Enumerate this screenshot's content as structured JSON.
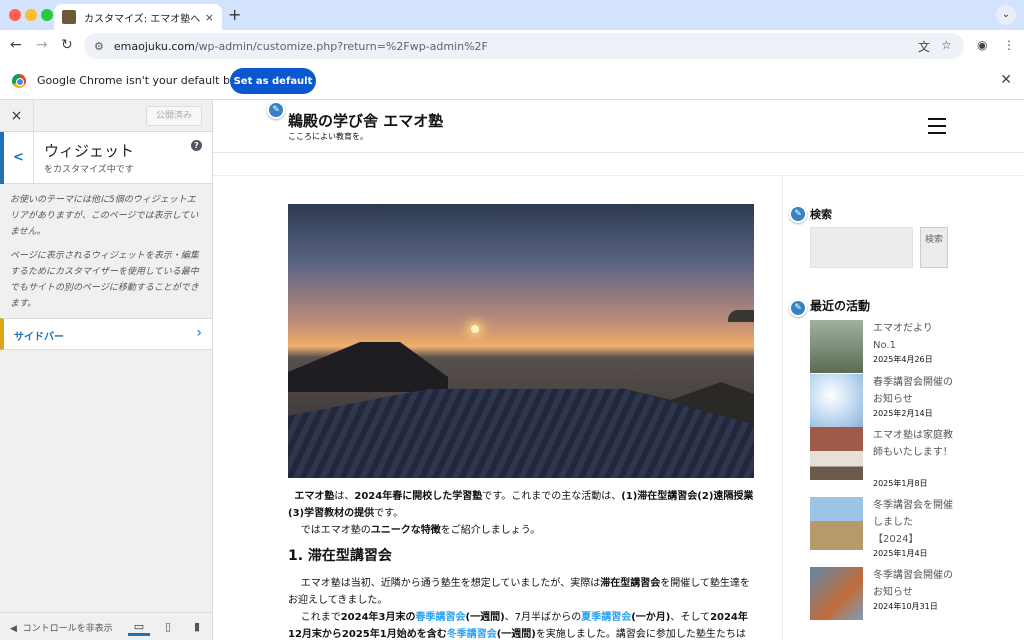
{
  "browser": {
    "tab_title": "カスタマイズ: エマオ塾へようこそ",
    "tab_close": "×",
    "new_tab": "+",
    "url_host": "emaojuku.com",
    "url_path": "/wp-admin/customize.php?return=%2Fwp-admin%2F",
    "infobar_text": "Google Chrome isn't your default browser",
    "set_default_label": "Set as default",
    "colors": {
      "tabstrip": "#d3e3fd",
      "accent": "#0b57d0",
      "red": "#ff5f57",
      "yellow": "#febc2e",
      "green": "#28c840"
    }
  },
  "customizer": {
    "close": "×",
    "publish_label": "公開済み",
    "section_title": "ウィジェット",
    "section_sub": "をカスタマイズ中です",
    "help": "?",
    "desc1": "お使いのテーマには他に5個のウィジェットエリアがありますが、このページでは表示していません。",
    "desc2": "ページに表示されるウィジェットを表示・編集するためにカスタマイザーを使用している最中でもサイトの別のページに移動することができます。",
    "area_label": "サイドバー",
    "hide_controls": "コントロールを非表示",
    "accent": "#2271b1"
  },
  "site": {
    "title": "鵜殿の学び舎 エマオ塾",
    "tagline": "こころによい教育を。",
    "para1_a": "エマオ塾",
    "para1_b": "は、",
    "para1_c": "2024年春に開校した学習塾",
    "para1_d": "です。これまでの主な活動は、",
    "para1_e": "(1)滞在型講習会(2)遠隔授業(3)学習教材の提供",
    "para1_f": "です。",
    "para2_a": "ではエマオ塾の",
    "para2_b": "ユニークな特徴",
    "para2_c": "をご紹介しましょう。",
    "heading1": "1. 滞在型講習会",
    "para3_a": "エマオ塾は当初、近隣から通う塾生を想定していましたが、実際は",
    "para3_b": "滞在型講習会",
    "para3_c": "を開催して塾生達をお迎えしてきました。",
    "para4_a": "これまで",
    "para4_b": "2024年3月末の",
    "para4_c": "春季講習会",
    "para4_d": "(一週間)",
    "para4_e": "、7月半ばからの",
    "para4_f": "夏季講習会",
    "para4_g": "(一か月)",
    "para4_h": "、そして",
    "para4_i": "2024年12月末から2025年1月始めを含む",
    "para4_j": "冬季講習会",
    "para4_k": "(一週間)",
    "para4_l": "を実施しました。講習会に参加した塾生たちは皆遠方か"
  },
  "sidebar": {
    "search_heading": "検索",
    "search_button": "検索",
    "recent_heading": "最近の活動",
    "posts": [
      {
        "title": "エマオだより No.1",
        "date": "2025年4月26日"
      },
      {
        "title": "春季講習会開催のお知らせ",
        "date": "2025年2月14日"
      },
      {
        "title": "エマオ塾は家庭教師もいたします！",
        "date": "2025年1月8日"
      },
      {
        "title": "冬季講習会を開催しました【2024】",
        "date": "2025年1月4日"
      },
      {
        "title": "冬季講習会開催のお知らせ",
        "date": "2024年10月31日"
      }
    ]
  }
}
